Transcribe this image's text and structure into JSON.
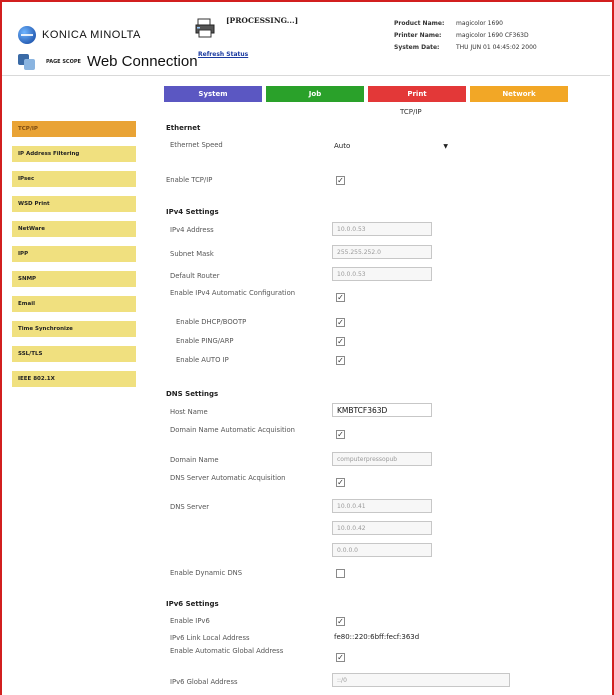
{
  "header": {
    "brand": "KONICA MINOLTA",
    "product_logo_small": "PAGE SCOPE",
    "product_logo": "Web Connection",
    "status": "[PROCESSING...]",
    "refresh_label": "Refresh Status",
    "info": [
      {
        "key": "Product Name:",
        "value": "magicolor 1690"
      },
      {
        "key": "Printer Name:",
        "value": "magicolor 1690 CF363D"
      },
      {
        "key": "System Date:",
        "value": "THU JUN 01 04:45:02 2000"
      }
    ]
  },
  "tabs": [
    {
      "label": "System"
    },
    {
      "label": "Job"
    },
    {
      "label": "Print"
    },
    {
      "label": "Network"
    }
  ],
  "section_title": "TCP/IP",
  "sidebar": {
    "items": [
      {
        "label": "TCP/IP",
        "active": true
      },
      {
        "label": "IP Address Filtering"
      },
      {
        "label": "IPsec"
      },
      {
        "label": "WSD Print"
      },
      {
        "label": "NetWare"
      },
      {
        "label": "IPP"
      },
      {
        "label": "SNMP"
      },
      {
        "label": "Email"
      },
      {
        "label": "Time Synchronize"
      },
      {
        "label": "SSL/TLS"
      },
      {
        "label": "IEEE 802.1X"
      }
    ]
  },
  "form": {
    "ethernet": {
      "title": "Ethernet",
      "speed_label": "Ethernet Speed",
      "speed_value": "Auto",
      "enable_tcpip_label": "Enable TCP/IP",
      "enable_tcpip": true
    },
    "ipv4": {
      "title": "IPv4 Settings",
      "address_label": "IPv4 Address",
      "address_value": "10.0.0.53",
      "subnet_label": "Subnet Mask",
      "subnet_value": "255.255.252.0",
      "router_label": "Default Router",
      "router_value": "10.0.0.53",
      "auto_config_label": "Enable IPv4 Automatic Configuration",
      "auto_config": true,
      "dhcp_label": "Enable DHCP/BOOTP",
      "dhcp": true,
      "ping_label": "Enable PING/ARP",
      "ping": true,
      "autoip_label": "Enable AUTO IP",
      "autoip": true
    },
    "dns": {
      "title": "DNS Settings",
      "host_label": "Host Name",
      "host_value": "KMBTCF363D",
      "domain_auto_label": "Domain Name Automatic Acquisition",
      "domain_auto": true,
      "domain_label": "Domain Name",
      "domain_value": "computerpressopub",
      "server_auto_label": "DNS Server Automatic Acquisition",
      "server_auto": true,
      "server_label": "DNS Server",
      "server_values": [
        "10.0.0.41",
        "10.0.0.42",
        "0.0.0.0"
      ],
      "dynamic_label": "Enable Dynamic DNS",
      "dynamic": false
    },
    "ipv6": {
      "title": "IPv6 Settings",
      "enable_label": "Enable IPv6",
      "enable": true,
      "link_local_label": "IPv6 Link Local Address",
      "link_local_value": "fe80::220:6bff:fecf:363d",
      "auto_global_label": "Enable Automatic Global Address",
      "auto_global": true,
      "global_label": "IPv6 Global Address",
      "global_value": "::/0"
    }
  }
}
